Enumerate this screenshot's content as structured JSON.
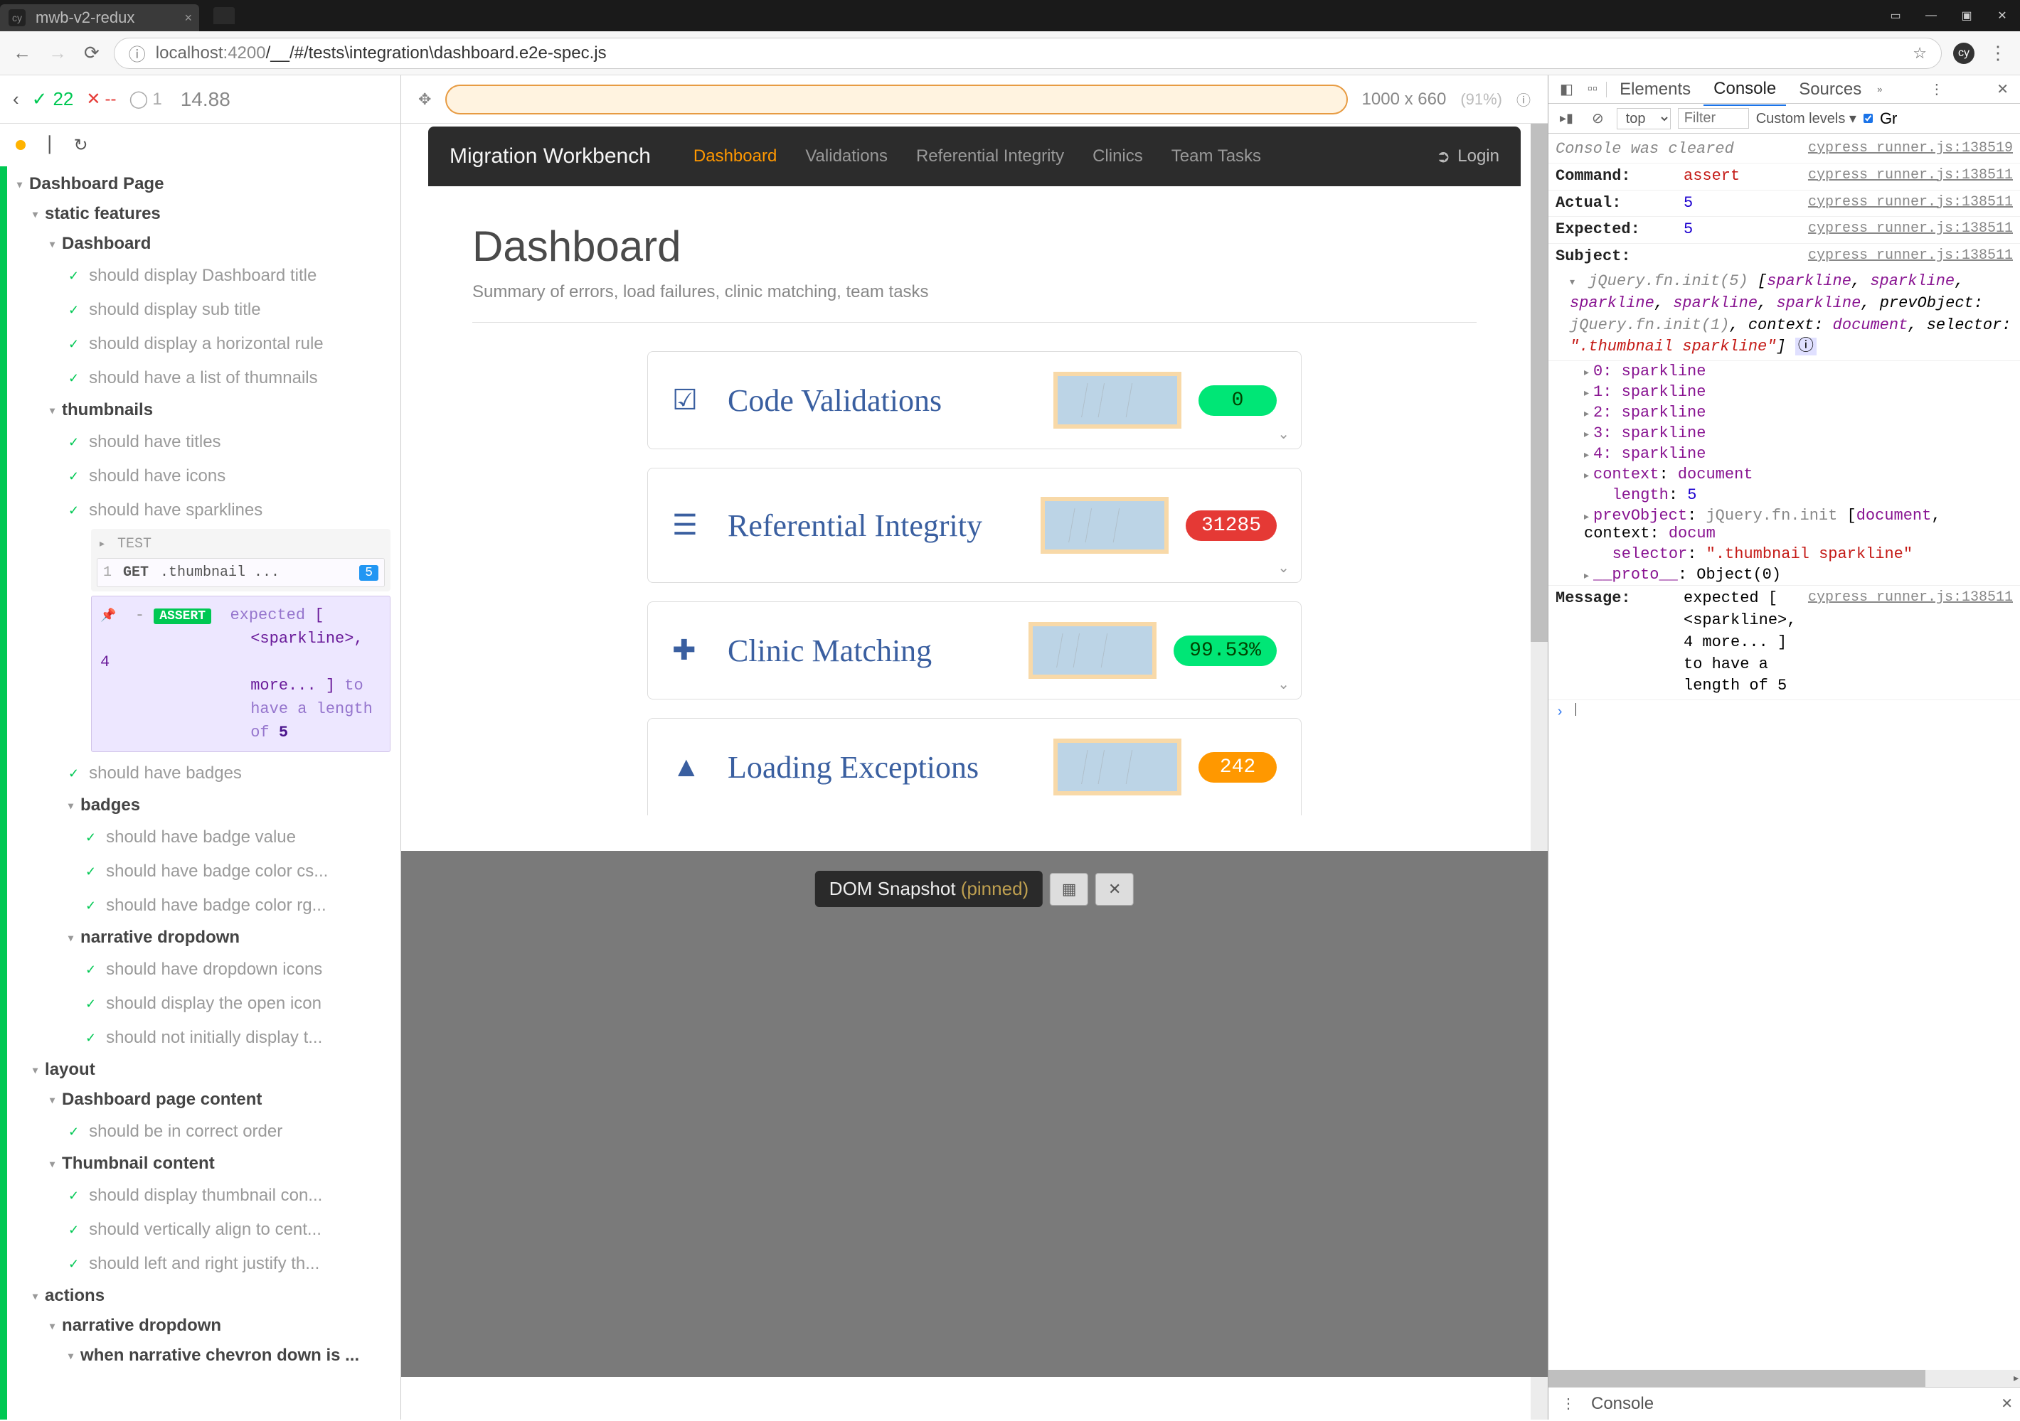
{
  "browser": {
    "tab_title": "mwb-v2-redux",
    "url_host": "localhost",
    "url_port": ":4200",
    "url_path": "/__/#/tests\\integration\\dashboard.e2e-spec.js"
  },
  "cypress": {
    "pass_count": "22",
    "fail_count": "--",
    "pending_count": "1",
    "duration": "14.88",
    "root_suite": "Dashboard Page",
    "suites": {
      "static_features": "static features",
      "dashboard": "Dashboard",
      "thumbnails": "thumbnails",
      "badges": "badges",
      "narrative_dropdown": "narrative dropdown",
      "layout": "layout",
      "dashboard_page_content": "Dashboard page content",
      "thumbnail_content": "Thumbnail content",
      "actions": "actions",
      "narrative_dropdown2": "narrative dropdown",
      "when_chevron": "when narrative chevron down is ..."
    },
    "tests": {
      "display_title": "should display Dashboard title",
      "display_subtitle": "should display sub title",
      "display_hr": "should display a horizontal rule",
      "have_thumbnails": "should have a list of thumnails",
      "have_titles": "should have titles",
      "have_icons": "should have icons",
      "have_sparklines": "should have sparklines",
      "have_badges": "should have badges",
      "have_badge_value": "should have badge value",
      "have_badge_color_cs": "should have badge color cs...",
      "have_badge_color_rg": "should have badge color rg...",
      "have_dropdown_icons": "should have dropdown icons",
      "display_open_icon": "should display the open icon",
      "not_display_t": "should not initially display t...",
      "correct_order": "should be in correct order",
      "thumbnail_con": "should display thumbnail con...",
      "vertically_align": "should vertically align to cent...",
      "left_right_justify": "should left and right justify th..."
    },
    "command": {
      "label": "TEST",
      "row_num": "1",
      "method": "GET",
      "selector": ".thumbnail ...",
      "count": "5",
      "assert_tag": "ASSERT",
      "assert_text": "expected [ <sparkline>, 4 more... ] to have a length of 5"
    }
  },
  "aut": {
    "dimensions": "1000 x 660",
    "scale_pct": "(91%)",
    "snapshot_label": "DOM Snapshot",
    "snapshot_state": "(pinned)"
  },
  "app": {
    "brand": "Migration Workbench",
    "nav": {
      "dashboard": "Dashboard",
      "validations": "Validations",
      "referential": "Referential Integrity",
      "clinics": "Clinics",
      "team_tasks": "Team Tasks",
      "login": "Login"
    },
    "title": "Dashboard",
    "subtitle": "Summary of errors, load failures, clinic matching, team tasks",
    "cards": {
      "code_validations": {
        "title": "Code Validations",
        "badge": "0"
      },
      "referential": {
        "title": "Referential Integrity",
        "badge": "31285"
      },
      "clinic": {
        "title": "Clinic Matching",
        "badge": "99.53%"
      },
      "loading": {
        "title": "Loading Exceptions",
        "badge": "242"
      }
    }
  },
  "devtools": {
    "tabs": {
      "elements": "Elements",
      "console": "Console",
      "sources": "Sources"
    },
    "context": "top",
    "filter_placeholder": "Filter",
    "levels": "Custom levels",
    "gr": "Gr",
    "console_cleared": "Console was cleared",
    "source_link_1": "cypress runner.js:138519",
    "source_link_2": "cypress runner.js:138511",
    "rows": {
      "command": {
        "k": "Command:",
        "v": "assert"
      },
      "actual": {
        "k": "Actual:",
        "v": "5"
      },
      "expected": {
        "k": "Expected:",
        "v": "5"
      },
      "subject": {
        "k": "Subject:"
      },
      "message": {
        "k": "Message:",
        "v": "expected [ <sparkline>, 4 more... ] to have a length of 5"
      }
    },
    "subject_obj": "jQuery.fn.init(5) [sparkline, sparkline, sparkline, sparkline, sparkline, prevObject: jQuery.fn.init(1), context: document, selector: \".thumbnail sparkline\"]",
    "sublist": {
      "i0": "0: sparkline",
      "i1": "1: sparkline",
      "i2": "2: sparkline",
      "i3": "3: sparkline",
      "i4": "4: sparkline",
      "ctx": "context: document",
      "len": "length: 5",
      "prev": "prevObject: jQuery.fn.init [document, context: docum",
      "sel": "selector: \".thumbnail sparkline\"",
      "proto": "__proto__: Object(0)"
    },
    "drawer_tab": "Console"
  }
}
